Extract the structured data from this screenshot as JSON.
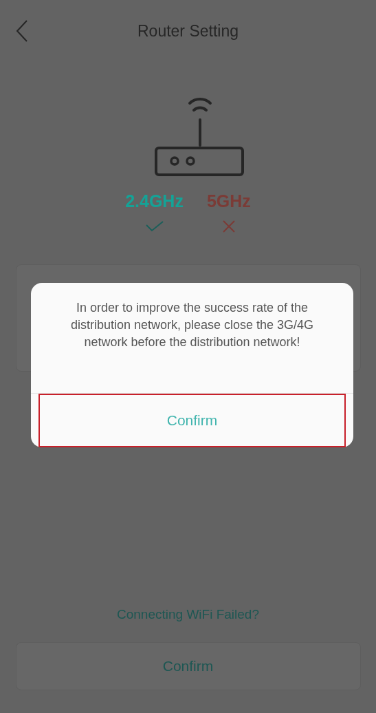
{
  "header": {
    "title": "Router Setting"
  },
  "bands": [
    {
      "label": "2.4GHz",
      "supported": true
    },
    {
      "label": "5GHz",
      "supported": false
    }
  ],
  "help_link": "Connecting WiFi Failed?",
  "footer_button": "Confirm",
  "dialog": {
    "message": "In order to improve the success rate of the distribution network, please close the 3G/4G network before the distribution network!",
    "button": {
      "label": "Confirm",
      "highlighted": true
    }
  }
}
